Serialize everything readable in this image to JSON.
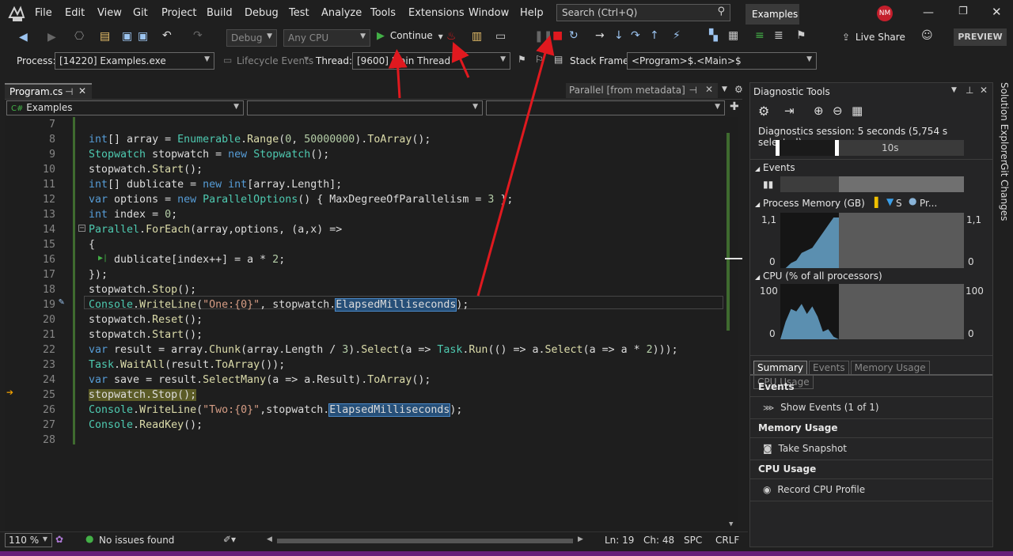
{
  "menu": [
    "File",
    "Edit",
    "View",
    "Git",
    "Project",
    "Build",
    "Debug",
    "Test",
    "Analyze",
    "Tools",
    "Extensions",
    "Window",
    "Help"
  ],
  "search_placeholder": "Search (Ctrl+Q)",
  "solution_name": "Examples",
  "avatar_initials": "NM",
  "toolbar": {
    "config": "Debug",
    "platform": "Any CPU",
    "continue_label": "Continue",
    "live_share": "Live Share",
    "preview": "PREVIEW"
  },
  "debugbar": {
    "process_label": "Process:",
    "process_value": "[14220] Examples.exe",
    "lifecycle": "Lifecycle Events",
    "thread_label": "Thread:",
    "thread_value": "[9600] Main Thread",
    "stack_label": "Stack Frame:",
    "stack_value": "<Program>$.<Main>$"
  },
  "editor": {
    "tab": "Program.cs",
    "meta_tab": "Parallel [from metadata]",
    "nav_project": "Examples",
    "lines": [
      {
        "n": "7",
        "t": ""
      },
      {
        "n": "8",
        "t": "int[] array = Enumerable.Range(0, 50000000).ToArray();"
      },
      {
        "n": "9",
        "t": "Stopwatch stopwatch = new Stopwatch();"
      },
      {
        "n": "10",
        "t": "stopwatch.Start();"
      },
      {
        "n": "11",
        "t": "int[] dublicate = new int[array.Length];"
      },
      {
        "n": "12",
        "t": "var options = new ParallelOptions() { MaxDegreeOfParallelism = 3 };"
      },
      {
        "n": "13",
        "t": "int index = 0;"
      },
      {
        "n": "14",
        "t": "Parallel.ForEach(array,options, (a,x) =>"
      },
      {
        "n": "15",
        "t": "{"
      },
      {
        "n": "16",
        "t": "    dublicate[index++] = a * 2;"
      },
      {
        "n": "17",
        "t": "});"
      },
      {
        "n": "18",
        "t": "stopwatch.Stop();"
      },
      {
        "n": "19",
        "t": "Console.WriteLine(\"One:{0}\", stopwatch.ElapsedMilliseconds);"
      },
      {
        "n": "20",
        "t": "stopwatch.Reset();"
      },
      {
        "n": "21",
        "t": "stopwatch.Start();"
      },
      {
        "n": "22",
        "t": "var result = array.Chunk(array.Length / 3).Select(a => Task.Run(() => a.Select(a => a * 2)));"
      },
      {
        "n": "23",
        "t": "Task.WaitAll(result.ToArray());"
      },
      {
        "n": "24",
        "t": "var save = result.SelectMany(a => a.Result).ToArray();"
      },
      {
        "n": "25",
        "t": "stopwatch.Stop();"
      },
      {
        "n": "26",
        "t": "Console.WriteLine(\"Two:{0}\",stopwatch.ElapsedMilliseconds);"
      },
      {
        "n": "27",
        "t": "Console.ReadKey();"
      },
      {
        "n": "28",
        "t": ""
      }
    ]
  },
  "status": {
    "zoom": "110 %",
    "issues": "No issues found",
    "ln": "Ln: 19",
    "ch": "Ch: 48",
    "spc": "SPC",
    "crlf": "CRLF"
  },
  "diagnostics": {
    "title": "Diagnostic Tools",
    "session": "Diagnostics session: 5 seconds (5,754 s selected)",
    "timeline_label": "10s",
    "events_header": "Events",
    "memory_header": "Process Memory (GB)",
    "memory_legend_s": "S",
    "memory_legend_pr": "Pr...",
    "memory_max": "1,1",
    "memory_min": "0",
    "memory_level": [
      0.0,
      0.0,
      0.1,
      0.15,
      0.3,
      0.35,
      0.4,
      0.55,
      0.7,
      0.85,
      1.0,
      1.0
    ],
    "cpu_header": "CPU (% of all processors)",
    "cpu_max": "100",
    "cpu_min": "0",
    "cpu_level": [
      0,
      35,
      60,
      55,
      70,
      50,
      65,
      45,
      15,
      20,
      5,
      0
    ],
    "tabs": [
      "Summary",
      "Events",
      "Memory Usage",
      "CPU Usage"
    ],
    "sec_events": "Events",
    "show_events": "Show Events (1 of 1)",
    "sec_memory": "Memory Usage",
    "take_snapshot": "Take Snapshot",
    "sec_cpu": "CPU Usage",
    "record_cpu": "Record CPU Profile"
  },
  "side": {
    "solution_explorer": "Solution Explorer",
    "git_changes": "Git Changes"
  },
  "colors": {
    "annotation_arrow": "#e0191f",
    "breakpoint_arrow": "#f0a000"
  }
}
